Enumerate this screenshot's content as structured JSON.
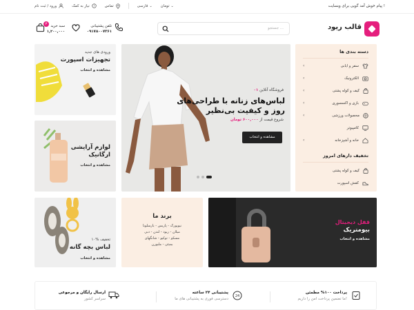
{
  "topbar": {
    "welcome": "پیام خوش آمد گویی برای وبسایت !",
    "currency": "تومان",
    "language": "فارسی",
    "contact": "تماس",
    "help": "نیاز به کمک",
    "auth": "ورود / ثبت نام"
  },
  "header": {
    "logo": "قالب ریود",
    "search_placeholder": "جستجو ...",
    "support_label": "تلفن پشتیبانی",
    "support_number": "۰۹۱۷۸۰۰۷۳۶۱",
    "cart_label": "سبد خرید",
    "cart_total": "۱,۲۰۰,۰۰۰",
    "cart_count": "۳"
  },
  "sidebar": {
    "title": "دسته بندی ها",
    "items": [
      {
        "label": "سفر و ایابی",
        "icon": "shirt-icon"
      },
      {
        "label": "الکترونیک",
        "icon": "camera-icon"
      },
      {
        "label": "کیف و کوله پشتی",
        "icon": "bag-icon"
      },
      {
        "label": "بازی و اکسسوری",
        "icon": "gamepad-icon"
      },
      {
        "label": "محصولات ورزشی",
        "icon": "ball-icon"
      },
      {
        "label": "کامپیوتر",
        "icon": "monitor-icon"
      },
      {
        "label": "خانه و آشپزخانه",
        "icon": "home-icon"
      }
    ],
    "offers_title": "تخفیف دارهای امروز",
    "offers": [
      {
        "label": "کیف و کوله پشتی",
        "icon": "bag-icon"
      },
      {
        "label": "کفش اسپورت",
        "icon": "shoe-icon"
      }
    ]
  },
  "hero": {
    "tag_number": "۰۱",
    "tag": "فروشگاه آنلاین",
    "title": "لباس‌های زنانه با طراحی‌های روز و کیفیت بی‌نظیر",
    "price_prefix": "شروع قیمت از",
    "price": "۶۰۰,۰۰۰ تومان",
    "button": "مشاهده و انتخاب"
  },
  "cards": {
    "sports": {
      "small": "ورودی های جدید",
      "large": "تجهیزات اسپورت",
      "link": "مشاهده و انتخاب"
    },
    "cosmetics": {
      "large1": "لوازم آرایشی",
      "large2": "ارگانیک",
      "link": "مشاهده و انتخاب"
    },
    "kids": {
      "small": "۱۰% تخفیف",
      "large": "لباس بچه گانه",
      "link": "مشاهده و انتخاب"
    },
    "brands": {
      "title": "برند ما",
      "lines": [
        "نیویورک - پاریس - بارسلونا",
        "میلان - ریود - لندن - دبی",
        "مسکو - توکیو - شانگهای",
        "بمبئی - ملبورن"
      ]
    },
    "lock": {
      "line1": "قفل دیجیتال",
      "line2": "بیومتریک",
      "link": "مشاهده و انتخاب"
    }
  },
  "features": [
    {
      "title": "پرداخت ۱۰۰% مطمئن",
      "sub": "ما تضمین پرداخت امن را داریم!"
    },
    {
      "title": "پشتیبانی ۲۴ ساعته",
      "sub": "دسترسی فوری به پشتیبانی های ما"
    },
    {
      "title": "ارسال رایگان و مرجوعی",
      "sub": "سراسر کشور"
    }
  ],
  "colors": {
    "accent": "#e51e7d",
    "peach": "#fbeee3",
    "dark": "#222222"
  }
}
